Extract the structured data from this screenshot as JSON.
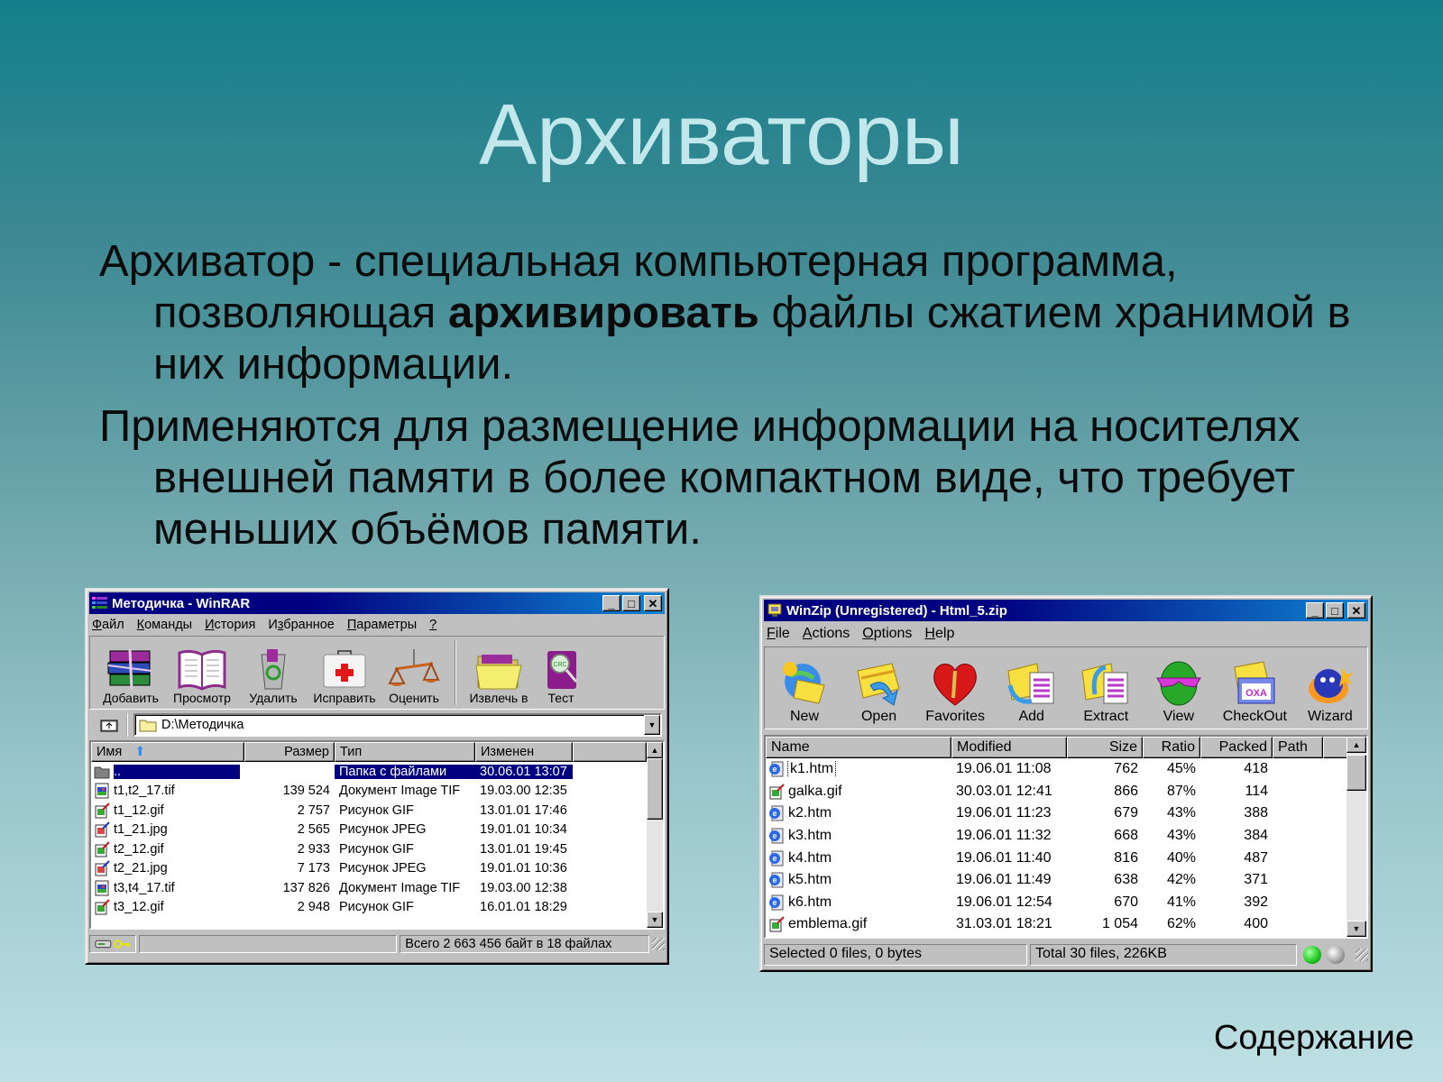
{
  "slide": {
    "title": "Архиваторы",
    "bullets": [
      {
        "before": "Архиватор - специальная компьютерная программа, позволяющая ",
        "bold": "архивировать",
        "after": " файлы сжатием хранимой в них информации."
      },
      {
        "before": "Применяются для размещение информации на носителях внешней памяти в более компактном виде, что требует меньших объёмов памяти.",
        "bold": "",
        "after": ""
      }
    ],
    "contents_link": "Содержание"
  },
  "winrar": {
    "title": "Методичка - WinRAR",
    "menu": [
      {
        "u": "Ф",
        "rest": "айл"
      },
      {
        "u": "К",
        "rest": "оманды"
      },
      {
        "u": "И",
        "rest": "стория"
      },
      {
        "pre": "И",
        "u": "з",
        "rest": "бранное"
      },
      {
        "u": "П",
        "rest": "араметры"
      },
      {
        "u": "?",
        "rest": ""
      }
    ],
    "toolbar": [
      {
        "label": "Добавить",
        "icon": "books-archive-icon"
      },
      {
        "label": "Просмотр",
        "icon": "open-book-icon"
      },
      {
        "label": "Удалить",
        "icon": "recycle-bin-icon"
      },
      {
        "label": "Исправить",
        "icon": "first-aid-kit-icon"
      },
      {
        "label": "Оценить",
        "icon": "scales-icon"
      },
      {
        "label": "Извлечь в",
        "icon": "folder-extract-icon"
      },
      {
        "label": "Тест",
        "icon": "crc-test-icon"
      }
    ],
    "path": "D:\\Методичка",
    "columns": [
      "Имя",
      "Размер",
      "Тип",
      "Изменен"
    ],
    "rows": [
      {
        "name": "..",
        "size": "",
        "type": "Папка с файлами",
        "modified": "30.06.01 13:07",
        "icon": "folder",
        "selected": true
      },
      {
        "name": "t1,t2_17.tif",
        "size": "139 524",
        "type": "Документ Image TIF",
        "modified": "19.03.00 12:35",
        "icon": "tif"
      },
      {
        "name": "t1_12.gif",
        "size": "2 757",
        "type": "Рисунок GIF",
        "modified": "13.01.01 17:46",
        "icon": "gif"
      },
      {
        "name": "t1_21.jpg",
        "size": "2 565",
        "type": "Рисунок JPEG",
        "modified": "19.01.01 10:34",
        "icon": "jpg"
      },
      {
        "name": "t2_12.gif",
        "size": "2 933",
        "type": "Рисунок GIF",
        "modified": "13.01.01 19:45",
        "icon": "gif"
      },
      {
        "name": "t2_21.jpg",
        "size": "7 173",
        "type": "Рисунок JPEG",
        "modified": "19.01.01 10:36",
        "icon": "jpg"
      },
      {
        "name": "t3,t4_17.tif",
        "size": "137 826",
        "type": "Документ Image TIF",
        "modified": "19.03.00 12:38",
        "icon": "tif"
      },
      {
        "name": "t3_12.gif",
        "size": "2 948",
        "type": "Рисунок GIF",
        "modified": "16.01.01 18:29",
        "icon": "gif"
      }
    ],
    "status": "Всего 2 663 456 байт в 18 файлах"
  },
  "winzip": {
    "title": "WinZip (Unregistered) - Html_5.zip",
    "menu": [
      {
        "u": "F",
        "rest": "ile"
      },
      {
        "u": "A",
        "rest": "ctions"
      },
      {
        "u": "O",
        "rest": "ptions"
      },
      {
        "u": "H",
        "rest": "elp"
      }
    ],
    "toolbar": [
      {
        "label": "New",
        "icon": "new-archive-icon"
      },
      {
        "label": "Open",
        "icon": "open-archive-icon"
      },
      {
        "label": "Favorites",
        "icon": "favorites-heart-icon"
      },
      {
        "label": "Add",
        "icon": "add-files-icon"
      },
      {
        "label": "Extract",
        "icon": "extract-files-icon"
      },
      {
        "label": "View",
        "icon": "view-icon"
      },
      {
        "label": "CheckOut",
        "icon": "checkout-icon"
      },
      {
        "label": "Wizard",
        "icon": "wizard-icon"
      }
    ],
    "columns": [
      "Name",
      "Modified",
      "Size",
      "Ratio",
      "Packed",
      "Path"
    ],
    "rows": [
      {
        "name": "k1.htm",
        "modified": "19.06.01 11:08",
        "size": "762",
        "ratio": "45%",
        "packed": "418",
        "icon": "htm",
        "focused": true
      },
      {
        "name": "galka.gif",
        "modified": "30.03.01 12:41",
        "size": "866",
        "ratio": "87%",
        "packed": "114",
        "icon": "gif"
      },
      {
        "name": "k2.htm",
        "modified": "19.06.01 11:23",
        "size": "679",
        "ratio": "43%",
        "packed": "388",
        "icon": "htm"
      },
      {
        "name": "k3.htm",
        "modified": "19.06.01 11:32",
        "size": "668",
        "ratio": "43%",
        "packed": "384",
        "icon": "htm"
      },
      {
        "name": "k4.htm",
        "modified": "19.06.01 11:40",
        "size": "816",
        "ratio": "40%",
        "packed": "487",
        "icon": "htm"
      },
      {
        "name": "k5.htm",
        "modified": "19.06.01 11:49",
        "size": "638",
        "ratio": "42%",
        "packed": "371",
        "icon": "htm"
      },
      {
        "name": "k6.htm",
        "modified": "19.06.01 12:54",
        "size": "670",
        "ratio": "41%",
        "packed": "392",
        "icon": "htm"
      },
      {
        "name": "emblema.gif",
        "modified": "31.03.01 18:21",
        "size": "1 054",
        "ratio": "62%",
        "packed": "400",
        "icon": "gif"
      }
    ],
    "status_selected": "Selected 0 files, 0 bytes",
    "status_total": "Total 30 files, 226KB"
  },
  "colors": {
    "titlebar_active": "#000080",
    "selection": "#000080",
    "led_green": "#22cc22",
    "led_gray": "#a8a8a8"
  }
}
